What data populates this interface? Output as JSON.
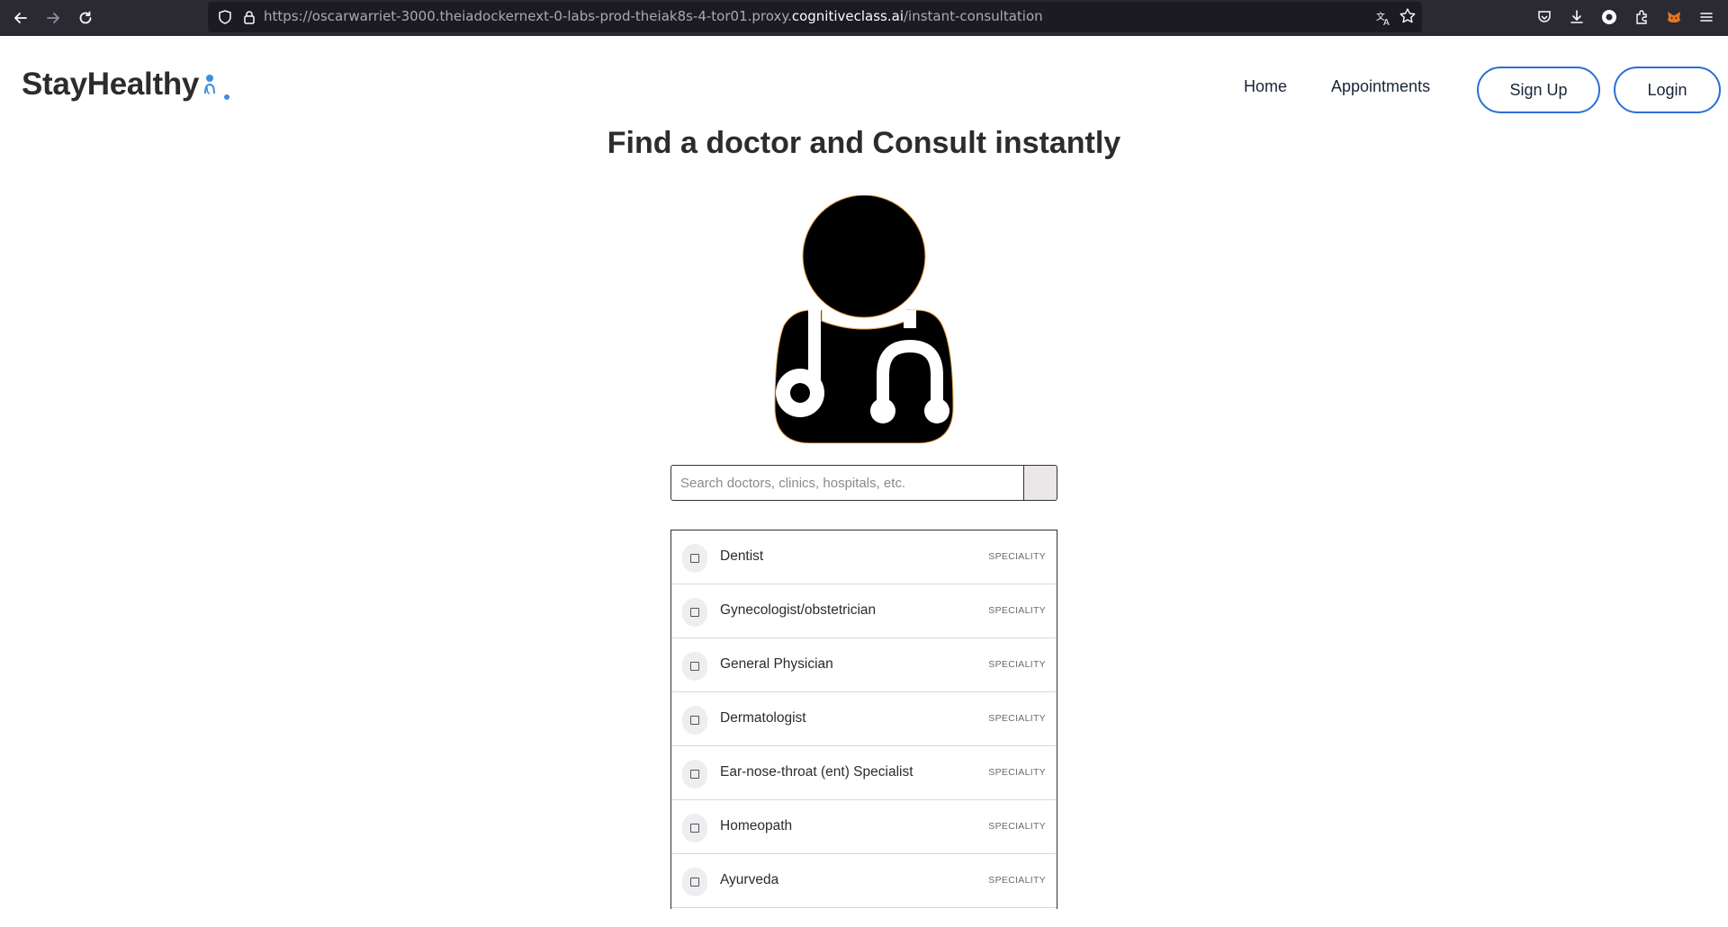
{
  "browser": {
    "url_prefix": "https://oscarwarriet-3000.theiadockernext-0-labs-prod-theiak8s-4-tor01.proxy.",
    "url_host": "cognitiveclass.ai",
    "url_path": "/instant-consultation"
  },
  "navbar": {
    "logo_text": "StayHealthy",
    "links": [
      {
        "label": "Home"
      },
      {
        "label": "Appointments"
      }
    ],
    "signup_label": "Sign Up",
    "login_label": "Login"
  },
  "main": {
    "heading": "Find a doctor and Consult instantly",
    "search": {
      "placeholder": "Search doctors, clinics, hospitals, etc.",
      "value": ""
    },
    "results": [
      {
        "label": "Dentist",
        "tag": "SPECIALITY"
      },
      {
        "label": "Gynecologist/obstetrician",
        "tag": "SPECIALITY"
      },
      {
        "label": "General Physician",
        "tag": "SPECIALITY"
      },
      {
        "label": "Dermatologist",
        "tag": "SPECIALITY"
      },
      {
        "label": "Ear-nose-throat (ent) Specialist",
        "tag": "SPECIALITY"
      },
      {
        "label": "Homeopath",
        "tag": "SPECIALITY"
      },
      {
        "label": "Ayurveda",
        "tag": "SPECIALITY"
      }
    ]
  },
  "colors": {
    "accent": "#2a6fd6",
    "logo_accent": "#3b8de0",
    "text": "#2c2c2c",
    "chrome_bg": "#2b2a33"
  }
}
